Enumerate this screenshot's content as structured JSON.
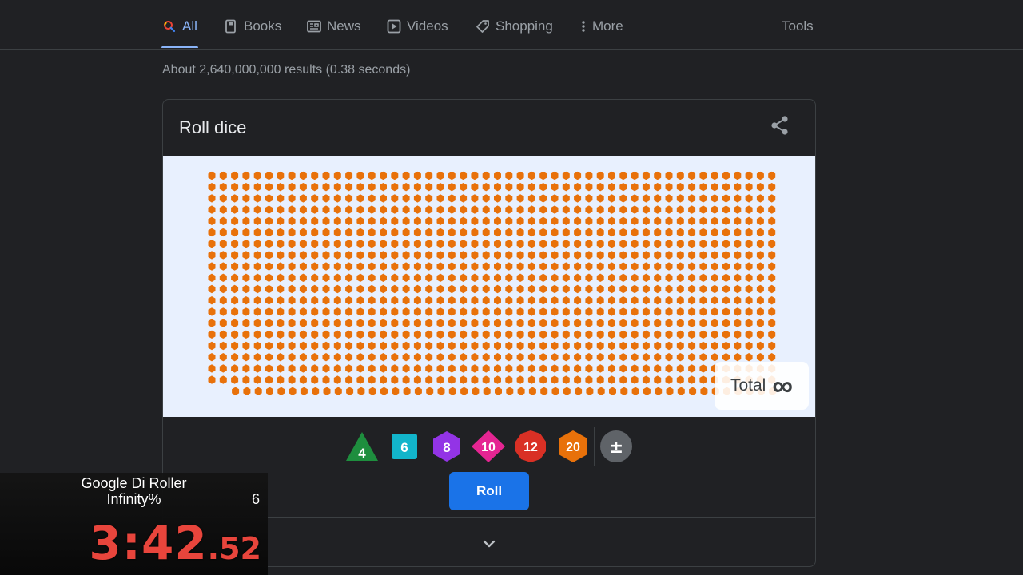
{
  "tabs": [
    {
      "label": "All",
      "icon": "search-icon",
      "active": true
    },
    {
      "label": "Books",
      "icon": "book-icon"
    },
    {
      "label": "News",
      "icon": "news-icon"
    },
    {
      "label": "Videos",
      "icon": "video-icon"
    },
    {
      "label": "Shopping",
      "icon": "tag-icon"
    },
    {
      "label": "More",
      "icon": "more-vert-icon"
    }
  ],
  "tools_label": "Tools",
  "result_stats": "About 2,640,000,000 results (0.38 seconds)",
  "card": {
    "title": "Roll dice",
    "total_label": "Total",
    "total_value": "∞",
    "dice": [
      {
        "label": "4",
        "shape": "triangle",
        "color": "#1e8e3e"
      },
      {
        "label": "6",
        "shape": "square",
        "color": "#12b5cb"
      },
      {
        "label": "8",
        "shape": "hexagon",
        "color": "#9334e6"
      },
      {
        "label": "10",
        "shape": "diamond",
        "color": "#e52592"
      },
      {
        "label": "12",
        "shape": "circle",
        "color": "#d93025"
      },
      {
        "label": "20",
        "shape": "hexagon",
        "color": "#e8710a"
      },
      {
        "label": "±",
        "shape": "circle",
        "color": "#5f6368"
      }
    ],
    "die_color": "#e8710a",
    "roll_label": "Roll"
  },
  "timer": {
    "game": "Google Di Roller",
    "category": "Infinity%",
    "attempts": "6",
    "time_main": "3:42",
    "time_ms": ".52"
  }
}
